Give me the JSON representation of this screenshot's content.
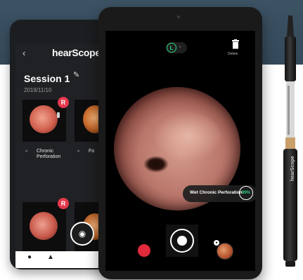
{
  "back_tablet": {
    "app_logo": "hearScope",
    "session_title": "Session 1",
    "session_date": "2019/11/10",
    "thumbnails": [
      {
        "badge": "R",
        "caption_line1": "Chronic",
        "caption_line2": "Perforation"
      },
      {
        "badge": "",
        "caption_line1": "Fo",
        "caption_line2": ""
      },
      {
        "badge": "R",
        "caption_line1": "",
        "caption_line2": ""
      },
      {
        "badge": "",
        "caption_line1": "",
        "caption_line2": ""
      }
    ]
  },
  "front_tablet": {
    "toggle_active": "L",
    "delete_label": "Delete",
    "result_label": "Wet Chronic Perforation",
    "result_score": "99%"
  },
  "device": {
    "brand": "hearScope"
  },
  "colors": {
    "background_band": "#3c5364",
    "accent_green": "#2bd17e",
    "badge_red": "#e5394c",
    "record_red": "#e12a3c"
  }
}
